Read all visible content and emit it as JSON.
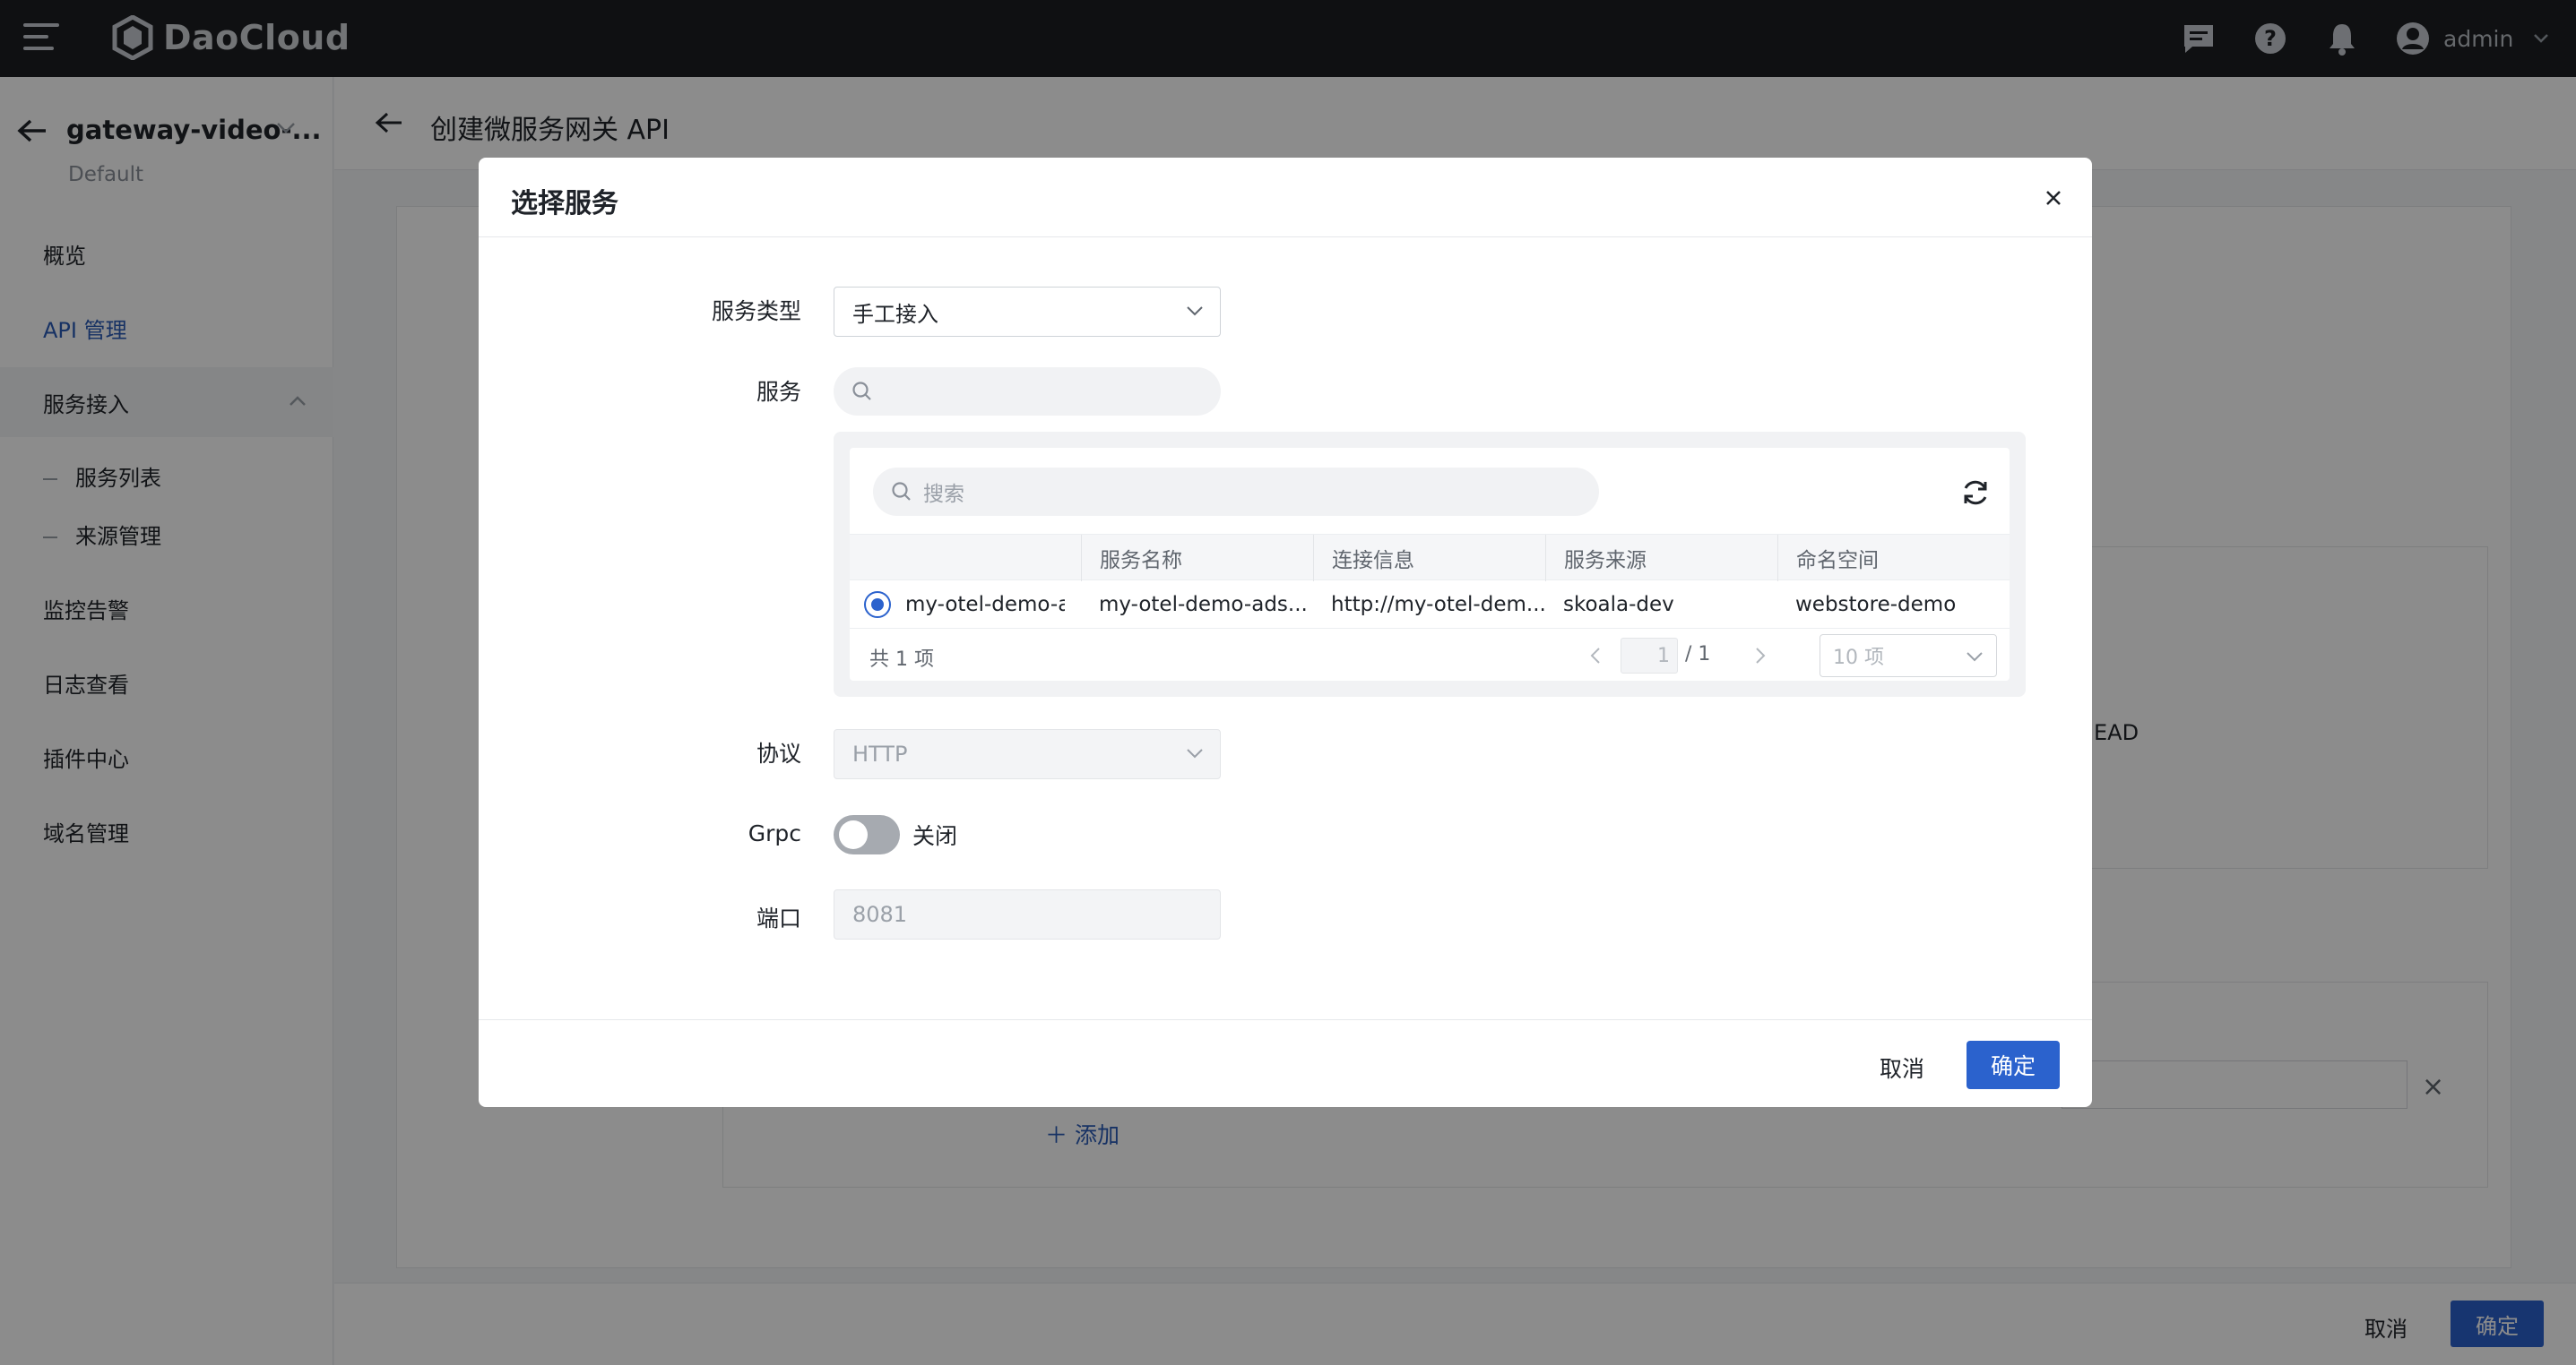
{
  "topbar": {
    "brand": "DaoCloud",
    "username": "admin"
  },
  "sidebar": {
    "gateway_name": "gateway-video-...",
    "workspace": "Default",
    "items": [
      {
        "label": "概览"
      },
      {
        "label": "API 管理"
      },
      {
        "label": "服务接入"
      },
      {
        "label": "服务列表"
      },
      {
        "label": "来源管理"
      },
      {
        "label": "监控告警"
      },
      {
        "label": "日志查看"
      },
      {
        "label": "插件中心"
      },
      {
        "label": "域名管理"
      }
    ]
  },
  "page": {
    "title": "创建微服务网关 API",
    "bg_methods_tail": "EAD",
    "add_label": "添加",
    "footer_cancel": "取消",
    "footer_ok": "确定"
  },
  "modal": {
    "title": "选择服务",
    "service_type_label": "服务类型",
    "service_type_value": "手工接入",
    "service_label": "服务",
    "service_search_placeholder": "",
    "list_search_placeholder": "搜索",
    "table": {
      "headers": [
        "",
        "服务名称",
        "连接信息",
        "服务来源",
        "命名空间"
      ],
      "rows": [
        {
          "selected": true,
          "name": "my-otel-demo-ad",
          "service_name": "my-otel-demo-ads...",
          "connection": "http://my-otel-dem...",
          "source": "skoala-dev",
          "namespace": "webstore-demo"
        }
      ]
    },
    "pagination": {
      "total": "共 1 项",
      "current_page": "1",
      "total_pages": "/ 1",
      "page_size": "10 项"
    },
    "protocol_label": "协议",
    "protocol_value": "HTTP",
    "grpc_label": "Grpc",
    "grpc_state": "关闭",
    "port_label": "端口",
    "port_value": "8081",
    "cancel_label": "取消",
    "ok_label": "确定"
  },
  "colors": {
    "primary": "#2b62cd",
    "topbar": "#1c1e22",
    "active_nav": "#2a5bb7"
  }
}
